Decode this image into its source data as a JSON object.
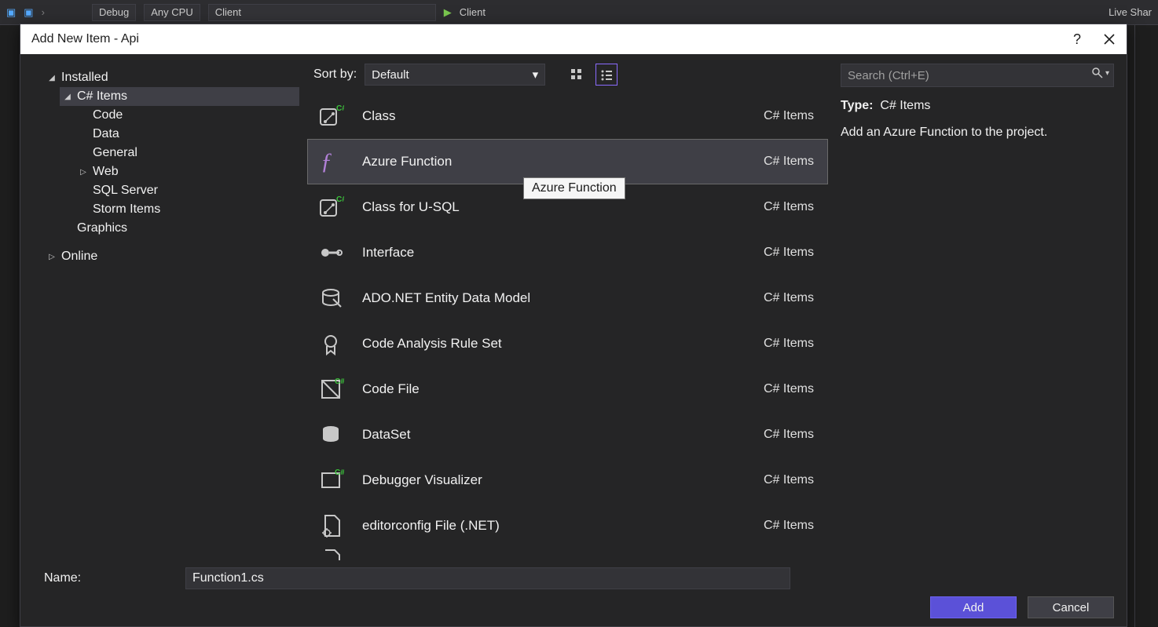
{
  "bg_toolbar": {
    "debug": "Debug",
    "anycpu": "Any CPU",
    "client_combo": "Client",
    "client_run": "Client",
    "live_share": "Live Shar"
  },
  "dialog": {
    "title": "Add New Item - Api",
    "help": "?",
    "sort_label": "Sort by:",
    "sort_value": "Default",
    "search_placeholder": "Search (Ctrl+E)",
    "type_label": "Type:",
    "type_value": "C# Items",
    "description": "Add an Azure Function to the project.",
    "name_label": "Name:",
    "name_value": "Function1.cs",
    "add_label": "Add",
    "cancel_label": "Cancel",
    "tooltip": "Azure Function"
  },
  "tree": {
    "installed": "Installed",
    "csharp_items": "C# Items",
    "children": [
      {
        "label": "Code"
      },
      {
        "label": "Data"
      },
      {
        "label": "General"
      },
      {
        "label": "Web",
        "has_children": true
      },
      {
        "label": "SQL Server"
      },
      {
        "label": "Storm Items"
      }
    ],
    "graphics": "Graphics",
    "online": "Online"
  },
  "templates": [
    {
      "name": "Class",
      "cat": "C# Items",
      "icon": "class"
    },
    {
      "name": "Azure Function",
      "cat": "C# Items",
      "icon": "azurefunc",
      "selected": true
    },
    {
      "name": "Class for U-SQL",
      "cat": "C# Items",
      "icon": "class"
    },
    {
      "name": "Interface",
      "cat": "C# Items",
      "icon": "interface"
    },
    {
      "name": "ADO.NET Entity Data Model",
      "cat": "C# Items",
      "icon": "entity"
    },
    {
      "name": "Code Analysis Rule Set",
      "cat": "C# Items",
      "icon": "ruleset"
    },
    {
      "name": "Code File",
      "cat": "C# Items",
      "icon": "codefile"
    },
    {
      "name": "DataSet",
      "cat": "C# Items",
      "icon": "dataset"
    },
    {
      "name": "Debugger Visualizer",
      "cat": "C# Items",
      "icon": "debugvis"
    },
    {
      "name": "editorconfig File (.NET)",
      "cat": "C# Items",
      "icon": "editorconfig"
    }
  ]
}
